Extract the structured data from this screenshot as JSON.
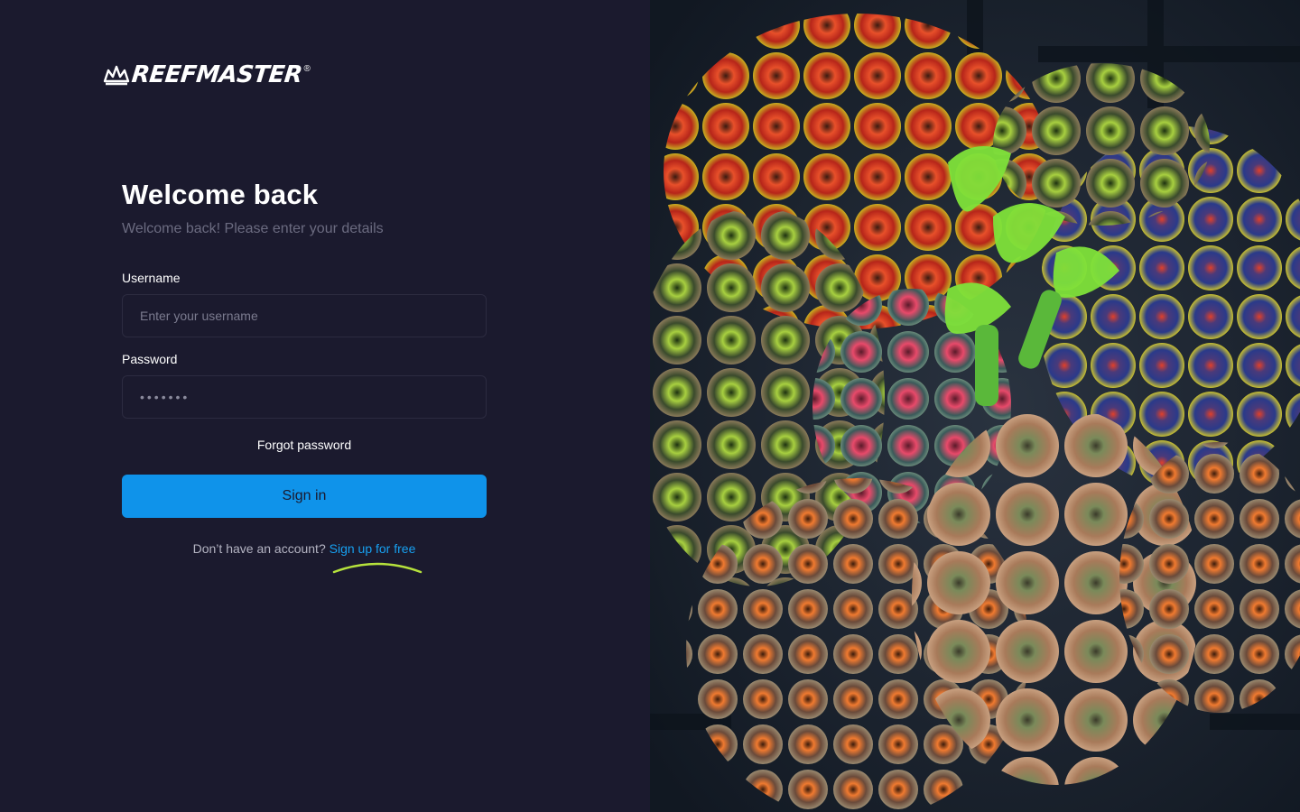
{
  "brand": {
    "name": "REEFMASTER",
    "registered": "®"
  },
  "login": {
    "title": "Welcome back",
    "subtitle": "Welcome back! Please enter your details",
    "username_label": "Username",
    "username_placeholder": "Enter your username",
    "password_label": "Password",
    "password_value": "•••••••",
    "forgot_label": "Forgot password",
    "signin_label": "Sign in",
    "signup_prompt": "Don’t have an account?",
    "signup_link": "Sign up for free"
  },
  "colors": {
    "background": "#1b1a2e",
    "accent": "#0f93ea",
    "link": "#17a0f0",
    "swoosh": "#b6e23c"
  },
  "icons": {
    "logo": "reef-crown-icon"
  }
}
